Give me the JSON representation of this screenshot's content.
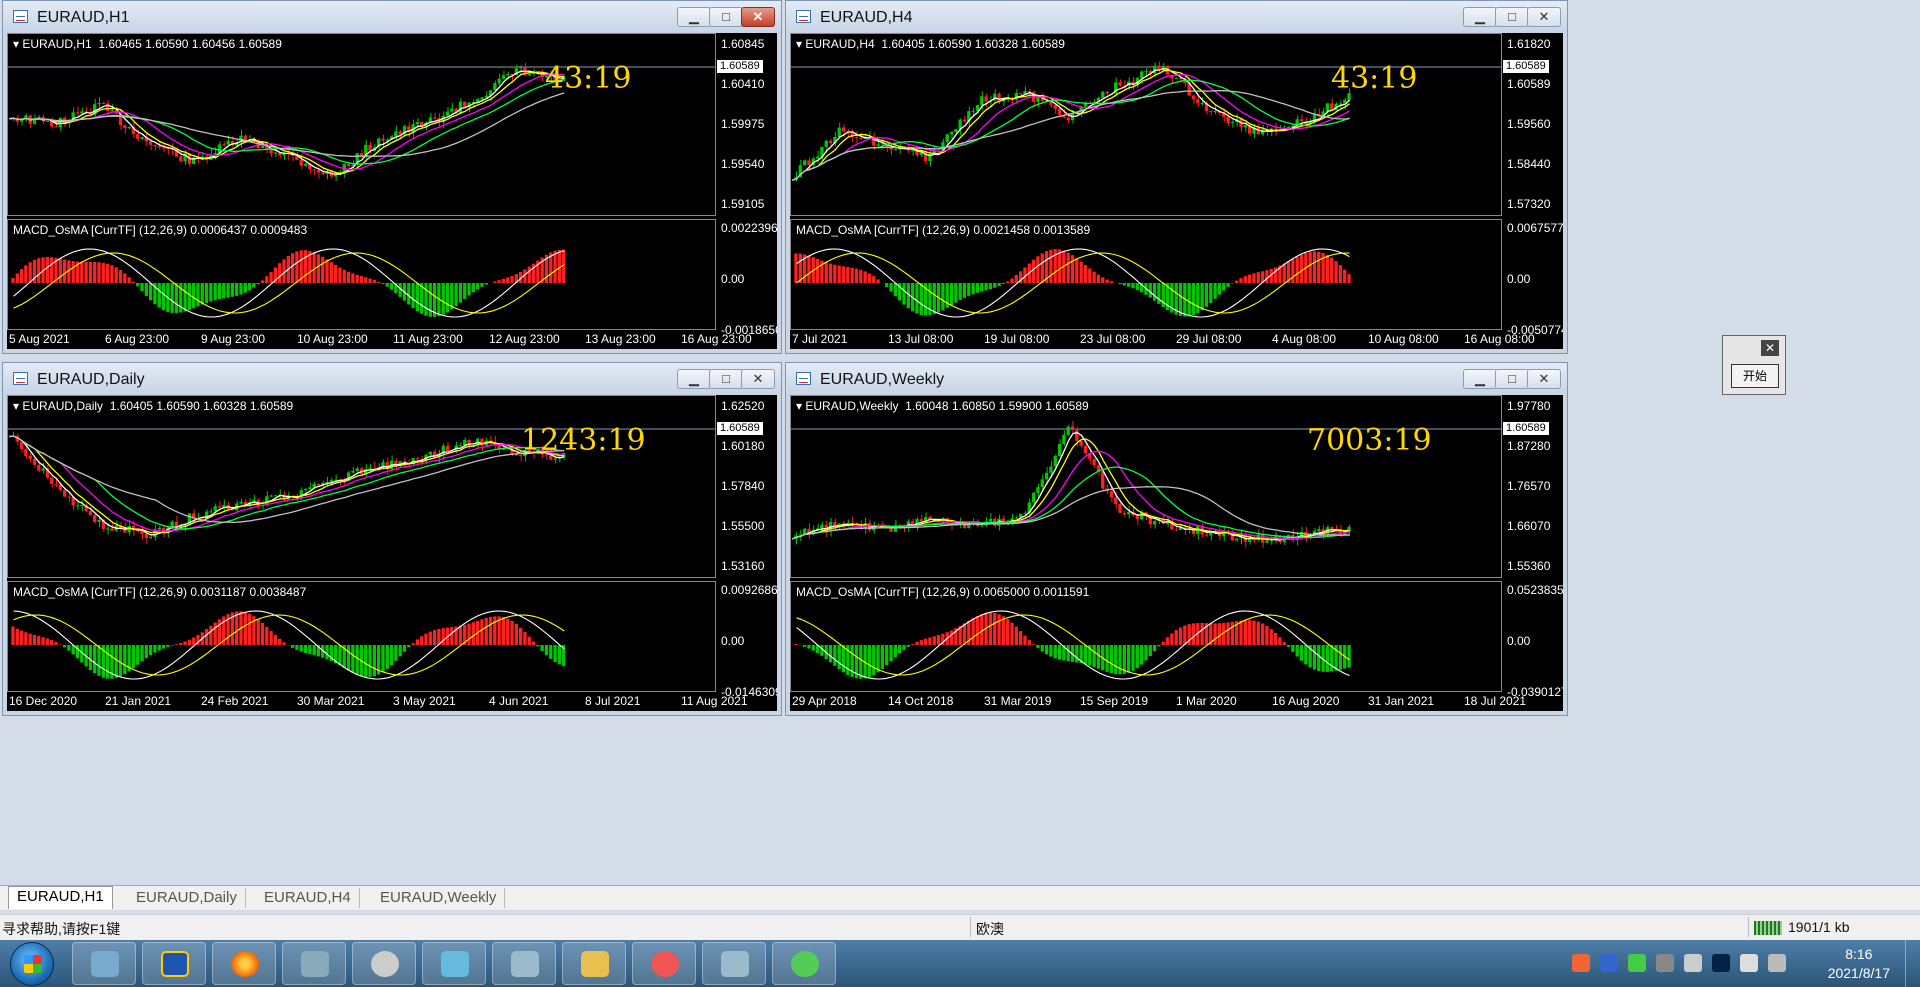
{
  "windows": [
    {
      "title": "EURAUD,H1",
      "ohlc": "EURAUD,H1  1.60465 1.60590 1.60456 1.60589",
      "price_labels": [
        "1.60845",
        "1.60410",
        "1.59975",
        "1.59540",
        "1.59105"
      ],
      "current_price": "1.60589",
      "timer": "43:19",
      "macd_label": "MACD_OsMA [CurrTF] (12,26,9) 0.0006437 0.0009483",
      "macd_labels": [
        "0.0022396",
        "0.00",
        "-0.0018656"
      ],
      "x_labels": [
        "5 Aug 2021",
        "6 Aug 23:00",
        "9 Aug 23:00",
        "10 Aug 23:00",
        "11 Aug 23:00",
        "12 Aug 23:00",
        "13 Aug 23:00",
        "16 Aug 23:00"
      ],
      "close_style": "red"
    },
    {
      "title": "EURAUD,H4",
      "ohlc": "EURAUD,H4  1.60405 1.60590 1.60328 1.60589",
      "price_labels": [
        "1.61820",
        "1.60589",
        "1.59560",
        "1.58440",
        "1.57320"
      ],
      "current_price": "1.60589",
      "timer": "43:19",
      "macd_label": "MACD_OsMA [CurrTF] (12,26,9) 0.0021458 0.0013589",
      "macd_labels": [
        "0.0067577",
        "0.00",
        "-0.0050774"
      ],
      "x_labels": [
        "7 Jul 2021",
        "13 Jul 08:00",
        "19 Jul 08:00",
        "23 Jul 08:00",
        "29 Jul 08:00",
        "4 Aug 08:00",
        "10 Aug 08:00",
        "16 Aug 08:00"
      ],
      "close_style": "normal"
    },
    {
      "title": "EURAUD,Daily",
      "ohlc": "EURAUD,Daily  1.60405 1.60590 1.60328 1.60589",
      "price_labels": [
        "1.62520",
        "1.60180",
        "1.57840",
        "1.55500",
        "1.53160"
      ],
      "current_price": "1.60589",
      "timer": "1243:19",
      "macd_label": "MACD_OsMA [CurrTF] (12,26,9) 0.0031187 0.0038487",
      "macd_labels": [
        "0.0092686",
        "0.00",
        "-0.0146309"
      ],
      "x_labels": [
        "16 Dec 2020",
        "21 Jan 2021",
        "24 Feb 2021",
        "30 Mar 2021",
        "3 May 2021",
        "4 Jun 2021",
        "8 Jul 2021",
        "11 Aug 2021"
      ],
      "close_style": "normal"
    },
    {
      "title": "EURAUD,Weekly",
      "ohlc": "EURAUD,Weekly  1.60048 1.60850 1.59900 1.60589",
      "price_labels": [
        "1.97780",
        "1.87280",
        "1.76570",
        "1.66070",
        "1.55360"
      ],
      "current_price": "1.60589",
      "timer": "7003:19",
      "macd_label": "MACD_OsMA [CurrTF] (12,26,9) 0.0065000 0.0011591",
      "macd_labels": [
        "0.0523835",
        "0.00",
        "-0.0390127"
      ],
      "x_labels": [
        "29 Apr 2018",
        "14 Oct 2018",
        "31 Mar 2019",
        "15 Sep 2019",
        "1 Mar 2020",
        "16 Aug 2020",
        "31 Jan 2021",
        "18 Jul 2021"
      ],
      "close_style": "normal"
    }
  ],
  "window_buttons": {
    "minimize": "▁",
    "maximize": "□",
    "close": "✕"
  },
  "dialog": {
    "close": "✕",
    "button": "开始"
  },
  "tabs": [
    "EURAUD,H1",
    "EURAUD,Daily",
    "EURAUD,H4",
    "EURAUD,Weekly"
  ],
  "active_tab": 0,
  "status": {
    "help": "寻求帮助,请按F1键",
    "profile": "欧澳",
    "traffic": "1901/1 kb"
  },
  "clock": {
    "time": "8:16",
    "date": "2021/8/17"
  },
  "colors": {
    "bull": "#00c800",
    "bear": "#ff2020",
    "ma_white": "#ffffff",
    "ma_yellow": "#ffff00",
    "ma_magenta": "#ff00ff",
    "ma_green": "#00ff40",
    "ma_gray": "#c0c0c0",
    "timer": "#ffd700"
  },
  "taskbar_icons": [
    "contacts-icon",
    "dollar-icon",
    "firefox-icon",
    "mt4-icon",
    "scanner-icon",
    "notepad-icon",
    "chart-tool-icon",
    "folder-icon",
    "game-icon",
    "chart-tool-icon-2",
    "wechat-icon"
  ]
}
